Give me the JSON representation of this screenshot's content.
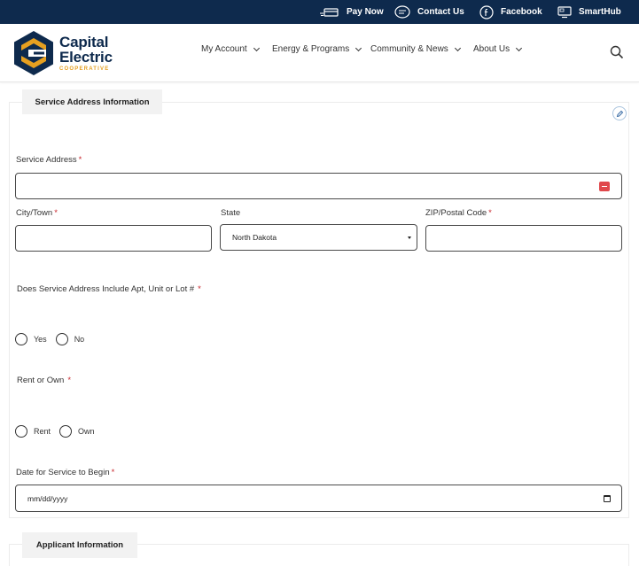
{
  "topbar": {
    "pay_now": "Pay Now",
    "contact_us": "Contact Us",
    "facebook": "Facebook",
    "smarthub": "SmartHub"
  },
  "brand": {
    "line1": "Capital",
    "line2": "Electric",
    "sub": "COOPERATIVE",
    "primary_color": "#0e2a4d",
    "accent_color": "#e6a020"
  },
  "nav": {
    "my_account": "My Account",
    "energy_programs": "Energy & Programs",
    "community_news": "Community & News",
    "about_us": "About Us"
  },
  "form": {
    "section_service": "Service Address Information",
    "section_applicant": "Applicant Information",
    "service_address_label": "Service Address",
    "city_label": "City/Town",
    "state_label": "State",
    "state_value": "North Dakota",
    "zip_label": "ZIP/Postal Code",
    "apt_question": "Does Service Address Include Apt, Unit or Lot #",
    "yes": "Yes",
    "no": "No",
    "rent_own_question": "Rent or Own",
    "rent": "Rent",
    "own": "Own",
    "date_label": "Date for Service to Begin",
    "date_placeholder": "mm/dd/yyyy",
    "required_mark": "*"
  }
}
